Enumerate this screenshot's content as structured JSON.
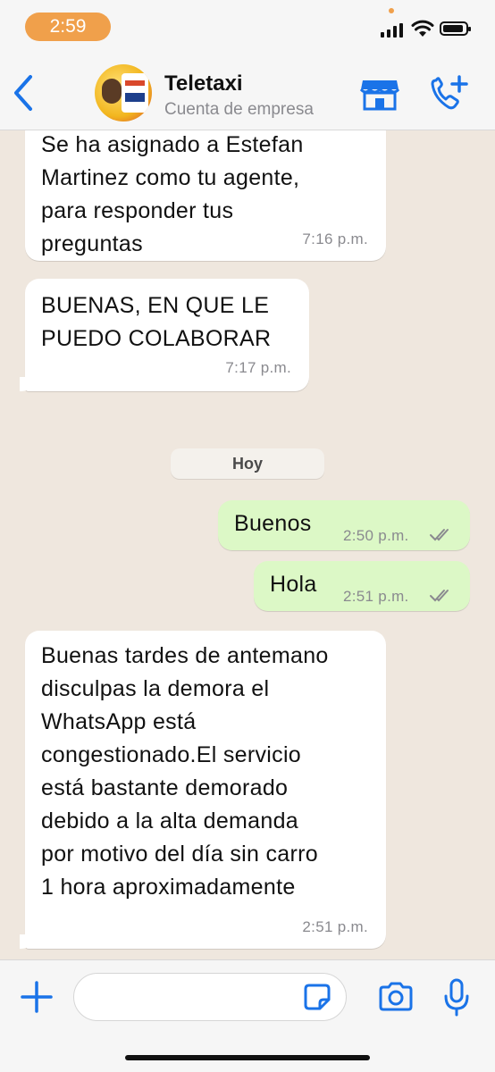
{
  "status_bar": {
    "time": "2:59",
    "accent": "#f0a04b"
  },
  "header": {
    "title": "Teletaxi",
    "subtitle": "Cuenta de empresa",
    "accent": "#1a73e8",
    "icons": [
      "chevron-left-icon",
      "store-icon",
      "add-call-icon"
    ]
  },
  "chat": {
    "day_separator": "Hoy",
    "messages": [
      {
        "direction": "incoming",
        "text": "Se ha asignado a Estefan\nMartinez como tu agente,\npara responder tus\npreguntas",
        "time": "7:16 p.m."
      },
      {
        "direction": "incoming",
        "text": "BUENAS, EN QUE LE\nPUEDO COLABORAR",
        "time": "7:17 p.m."
      },
      {
        "direction": "outgoing",
        "text": "Buenos",
        "time": "2:50 p.m.",
        "status": "read"
      },
      {
        "direction": "outgoing",
        "text": "Hola",
        "time": "2:51 p.m.",
        "status": "read"
      },
      {
        "direction": "incoming",
        "text": "Buenas tardes de antemano\ndisculpas la demora el\nWhatsApp está\ncongestionado.El servicio\nestá  bastante demorado\ndebido a la alta demanda\npor motivo del día sin carro\n1 hora aproximadamente",
        "time": "2:51 p.m."
      }
    ]
  },
  "input_bar": {
    "icons": [
      "plus-icon",
      "sticker-icon",
      "camera-icon",
      "mic-icon"
    ]
  }
}
